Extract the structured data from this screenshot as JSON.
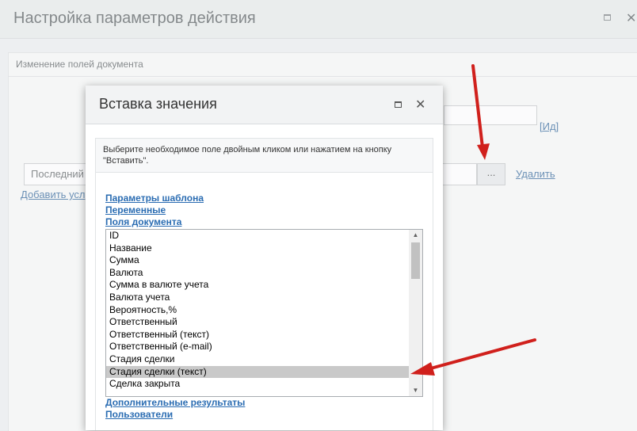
{
  "background_window": {
    "title": "Настройка параметров действия",
    "section_title": "Изменение полей документа",
    "field_value": "Последний",
    "id_link": "[Ид]",
    "browse_button": "...",
    "delete_link": "Удалить",
    "add_condition_link": "Добавить усл"
  },
  "modal": {
    "title": "Вставка значения",
    "hint": "Выберите необходимое поле двойным кликом или нажатием на кнопку \"Вставить\".",
    "groups_top": [
      "Параметры шаблона",
      "Переменные",
      "Поля документа"
    ],
    "groups_bottom": [
      "Дополнительные результаты",
      "Пользователи"
    ],
    "fields": [
      "ID",
      "Название",
      "Сумма",
      "Валюта",
      "Сумма в валюте учета",
      "Валюта учета",
      "Вероятность,%",
      "Ответственный",
      "Ответственный (текст)",
      "Ответственный (e-mail)",
      "Стадия сделки",
      "Стадия сделки (текст)",
      "Сделка закрыта"
    ],
    "selected_field": "Стадия сделки (текст)"
  },
  "icons": {
    "maximize": "maximize-icon",
    "close": "close-icon",
    "scroll_up": "scroll-up-icon",
    "scroll_down": "scroll-down-icon",
    "annotation": "red-arrow-icon"
  },
  "colors": {
    "link": "#2a6cb2",
    "selected_row": "#c9c9c9",
    "annotation_arrow": "#d0201c"
  }
}
